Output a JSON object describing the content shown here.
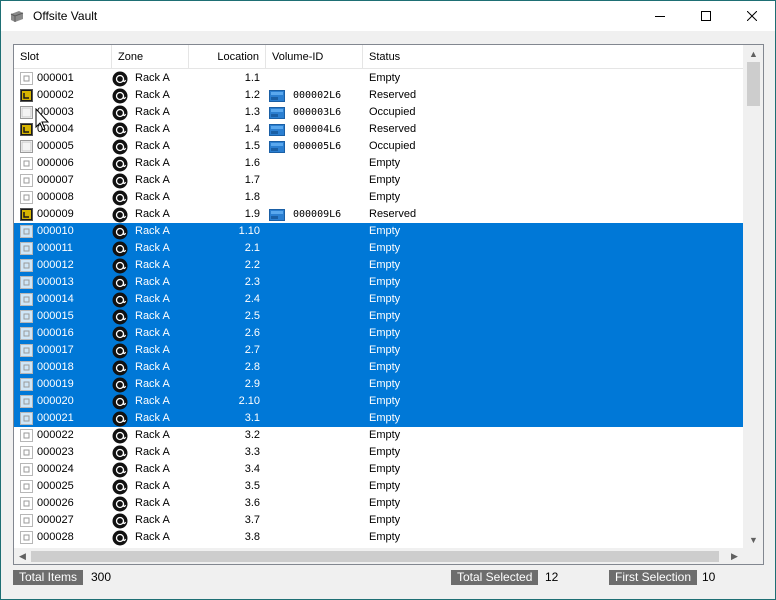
{
  "window": {
    "title": "Offsite Vault"
  },
  "columns": [
    "Slot",
    "Zone",
    "Location",
    "Volume-ID",
    "Status"
  ],
  "icons": {
    "app": "vault-app-icon",
    "slot_empty": "empty-slot-icon",
    "slot_reserved": "reserved-slot-icon",
    "slot_occupied": "occupied-slot-icon",
    "zone": "rack-zone-icon",
    "volume": "tape-volume-icon"
  },
  "colors": {
    "selection": "#0078d7",
    "status_label_bg": "#6d6d6d",
    "reserved_icon": "#c8a000"
  },
  "rows": [
    {
      "slot": "000001",
      "slot_icon": "empty",
      "zone": "Rack A",
      "location": "1.1",
      "volume": "",
      "status": "Empty",
      "selected": false
    },
    {
      "slot": "000002",
      "slot_icon": "reserved",
      "zone": "Rack A",
      "location": "1.2",
      "volume": "000002L6",
      "status": "Reserved",
      "selected": false
    },
    {
      "slot": "000003",
      "slot_icon": "occupied",
      "zone": "Rack A",
      "location": "1.3",
      "volume": "000003L6",
      "status": "Occupied",
      "selected": false
    },
    {
      "slot": "000004",
      "slot_icon": "reserved",
      "zone": "Rack A",
      "location": "1.4",
      "volume": "000004L6",
      "status": "Reserved",
      "selected": false
    },
    {
      "slot": "000005",
      "slot_icon": "occupied",
      "zone": "Rack A",
      "location": "1.5",
      "volume": "000005L6",
      "status": "Occupied",
      "selected": false
    },
    {
      "slot": "000006",
      "slot_icon": "empty",
      "zone": "Rack A",
      "location": "1.6",
      "volume": "",
      "status": "Empty",
      "selected": false
    },
    {
      "slot": "000007",
      "slot_icon": "empty",
      "zone": "Rack A",
      "location": "1.7",
      "volume": "",
      "status": "Empty",
      "selected": false
    },
    {
      "slot": "000008",
      "slot_icon": "empty",
      "zone": "Rack A",
      "location": "1.8",
      "volume": "",
      "status": "Empty",
      "selected": false
    },
    {
      "slot": "000009",
      "slot_icon": "reserved",
      "zone": "Rack A",
      "location": "1.9",
      "volume": "000009L6",
      "status": "Reserved",
      "selected": false
    },
    {
      "slot": "000010",
      "slot_icon": "empty",
      "zone": "Rack A",
      "location": "1.10",
      "volume": "",
      "status": "Empty",
      "selected": true
    },
    {
      "slot": "000011",
      "slot_icon": "empty",
      "zone": "Rack A",
      "location": "2.1",
      "volume": "",
      "status": "Empty",
      "selected": true
    },
    {
      "slot": "000012",
      "slot_icon": "empty",
      "zone": "Rack A",
      "location": "2.2",
      "volume": "",
      "status": "Empty",
      "selected": true
    },
    {
      "slot": "000013",
      "slot_icon": "empty",
      "zone": "Rack A",
      "location": "2.3",
      "volume": "",
      "status": "Empty",
      "selected": true
    },
    {
      "slot": "000014",
      "slot_icon": "empty",
      "zone": "Rack A",
      "location": "2.4",
      "volume": "",
      "status": "Empty",
      "selected": true
    },
    {
      "slot": "000015",
      "slot_icon": "empty",
      "zone": "Rack A",
      "location": "2.5",
      "volume": "",
      "status": "Empty",
      "selected": true
    },
    {
      "slot": "000016",
      "slot_icon": "empty",
      "zone": "Rack A",
      "location": "2.6",
      "volume": "",
      "status": "Empty",
      "selected": true
    },
    {
      "slot": "000017",
      "slot_icon": "empty",
      "zone": "Rack A",
      "location": "2.7",
      "volume": "",
      "status": "Empty",
      "selected": true
    },
    {
      "slot": "000018",
      "slot_icon": "empty",
      "zone": "Rack A",
      "location": "2.8",
      "volume": "",
      "status": "Empty",
      "selected": true
    },
    {
      "slot": "000019",
      "slot_icon": "empty",
      "zone": "Rack A",
      "location": "2.9",
      "volume": "",
      "status": "Empty",
      "selected": true
    },
    {
      "slot": "000020",
      "slot_icon": "empty",
      "zone": "Rack A",
      "location": "2.10",
      "volume": "",
      "status": "Empty",
      "selected": true
    },
    {
      "slot": "000021",
      "slot_icon": "empty",
      "zone": "Rack A",
      "location": "3.1",
      "volume": "",
      "status": "Empty",
      "selected": true
    },
    {
      "slot": "000022",
      "slot_icon": "empty",
      "zone": "Rack A",
      "location": "3.2",
      "volume": "",
      "status": "Empty",
      "selected": false
    },
    {
      "slot": "000023",
      "slot_icon": "empty",
      "zone": "Rack A",
      "location": "3.3",
      "volume": "",
      "status": "Empty",
      "selected": false
    },
    {
      "slot": "000024",
      "slot_icon": "empty",
      "zone": "Rack A",
      "location": "3.4",
      "volume": "",
      "status": "Empty",
      "selected": false
    },
    {
      "slot": "000025",
      "slot_icon": "empty",
      "zone": "Rack A",
      "location": "3.5",
      "volume": "",
      "status": "Empty",
      "selected": false
    },
    {
      "slot": "000026",
      "slot_icon": "empty",
      "zone": "Rack A",
      "location": "3.6",
      "volume": "",
      "status": "Empty",
      "selected": false
    },
    {
      "slot": "000027",
      "slot_icon": "empty",
      "zone": "Rack A",
      "location": "3.7",
      "volume": "",
      "status": "Empty",
      "selected": false
    },
    {
      "slot": "000028",
      "slot_icon": "empty",
      "zone": "Rack A",
      "location": "3.8",
      "volume": "",
      "status": "Empty",
      "selected": false
    }
  ],
  "status": {
    "total_items_label": "Total Items",
    "total_items": "300",
    "total_selected_label": "Total Selected",
    "total_selected": "12",
    "first_selection_label": "First Selection",
    "first_selection": "10"
  }
}
